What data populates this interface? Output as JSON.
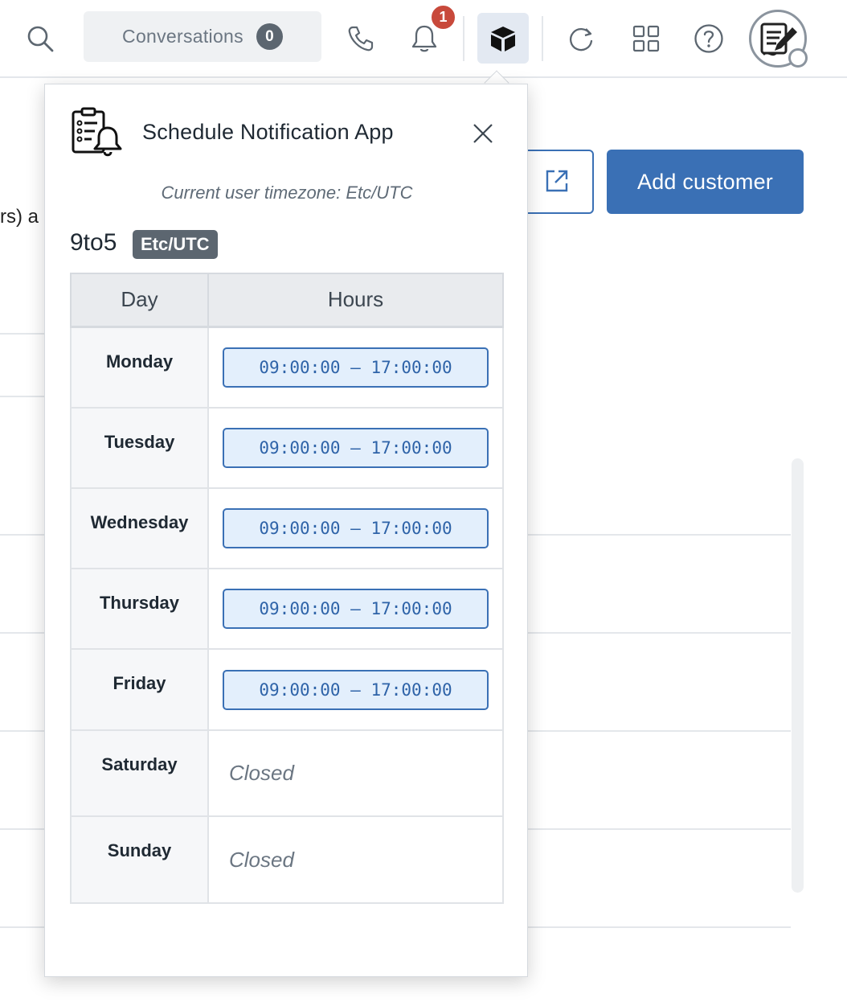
{
  "topbar": {
    "conversations_label": "Conversations",
    "conversations_count": "0",
    "notifications_count": "1"
  },
  "background": {
    "add_customer_label": "Add customer",
    "text_fragment": "rs) a"
  },
  "popover": {
    "app_title": "Schedule Notification App",
    "timezone_note": "Current user timezone: Etc/UTC",
    "schedule_name": "9to5",
    "schedule_timezone": "Etc/UTC",
    "table": {
      "day_header": "Day",
      "hours_header": "Hours",
      "rows": [
        {
          "day": "Monday",
          "hours": "09:00:00 – 17:00:00"
        },
        {
          "day": "Tuesday",
          "hours": "09:00:00 – 17:00:00"
        },
        {
          "day": "Wednesday",
          "hours": "09:00:00 – 17:00:00"
        },
        {
          "day": "Thursday",
          "hours": "09:00:00 – 17:00:00"
        },
        {
          "day": "Friday",
          "hours": "09:00:00 – 17:00:00"
        },
        {
          "day": "Saturday",
          "hours": "Closed"
        },
        {
          "day": "Sunday",
          "hours": "Closed"
        }
      ]
    }
  },
  "colors": {
    "accent": "#3a70b5",
    "badge_red": "#c8493b",
    "pill_bg": "#e3effc"
  }
}
